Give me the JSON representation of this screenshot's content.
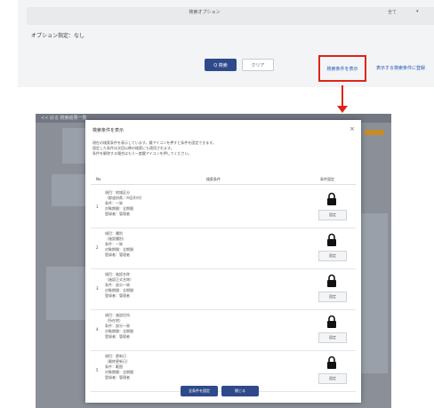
{
  "top": {
    "title": "検索オプション",
    "right_a": "全て",
    "right_b": "▾",
    "option_line": "オプション指定：なし",
    "search_button": "Q 検索",
    "clear_button": "クリア",
    "settings_button": "検索条件を表示",
    "save_link": "表示する検索条件に登録"
  },
  "background": {
    "title": "<< 戻る  検索結果一覧"
  },
  "modal": {
    "title": "検索条件を表示",
    "close": "×",
    "description": [
      "現在の検索条件を表示しています。鍵アイコンを押すと条件を固定できます。",
      "固定した条件は次回以降の検索にも適用されます。",
      "条件を解除する場合はもう一度鍵アイコンを押してください。"
    ],
    "columns": [
      "No",
      "検索条件",
      "条件固定"
    ],
    "rows": [
      {
        "no": "1",
        "lines": [
          "項目：地域区分",
          "（都道府県／市区町村）",
          "条件：一致",
          "対象期間：全期間",
          "登録者：管理者"
        ],
        "lock_label": "固定"
      },
      {
        "no": "2",
        "lines": [
          "項目：種別",
          "（施設種別）",
          "条件：一致",
          "対象期間：全期間",
          "登録者：管理者"
        ],
        "lock_label": "固定"
      },
      {
        "no": "3",
        "lines": [
          "項目：施設名称",
          "（施設正式名称）",
          "条件：部分一致",
          "対象期間：全期間",
          "登録者：管理者"
        ],
        "lock_label": "固定"
      },
      {
        "no": "4",
        "lines": [
          "項目：施設住所",
          "（所在地）",
          "条件：部分一致",
          "対象期間：全期間",
          "登録者：管理者"
        ],
        "lock_label": "固定"
      },
      {
        "no": "5",
        "lines": [
          "項目：更新日",
          "（最終更新日）",
          "条件：範囲",
          "対象期間：全期間",
          "登録者：管理者"
        ],
        "lock_label": "固定"
      }
    ],
    "button_a": "全条件を固定",
    "button_b": "閉じる"
  },
  "colors": {
    "accent": "#2f4a8a",
    "highlight": "#e0231a",
    "link": "#1e56b5"
  }
}
